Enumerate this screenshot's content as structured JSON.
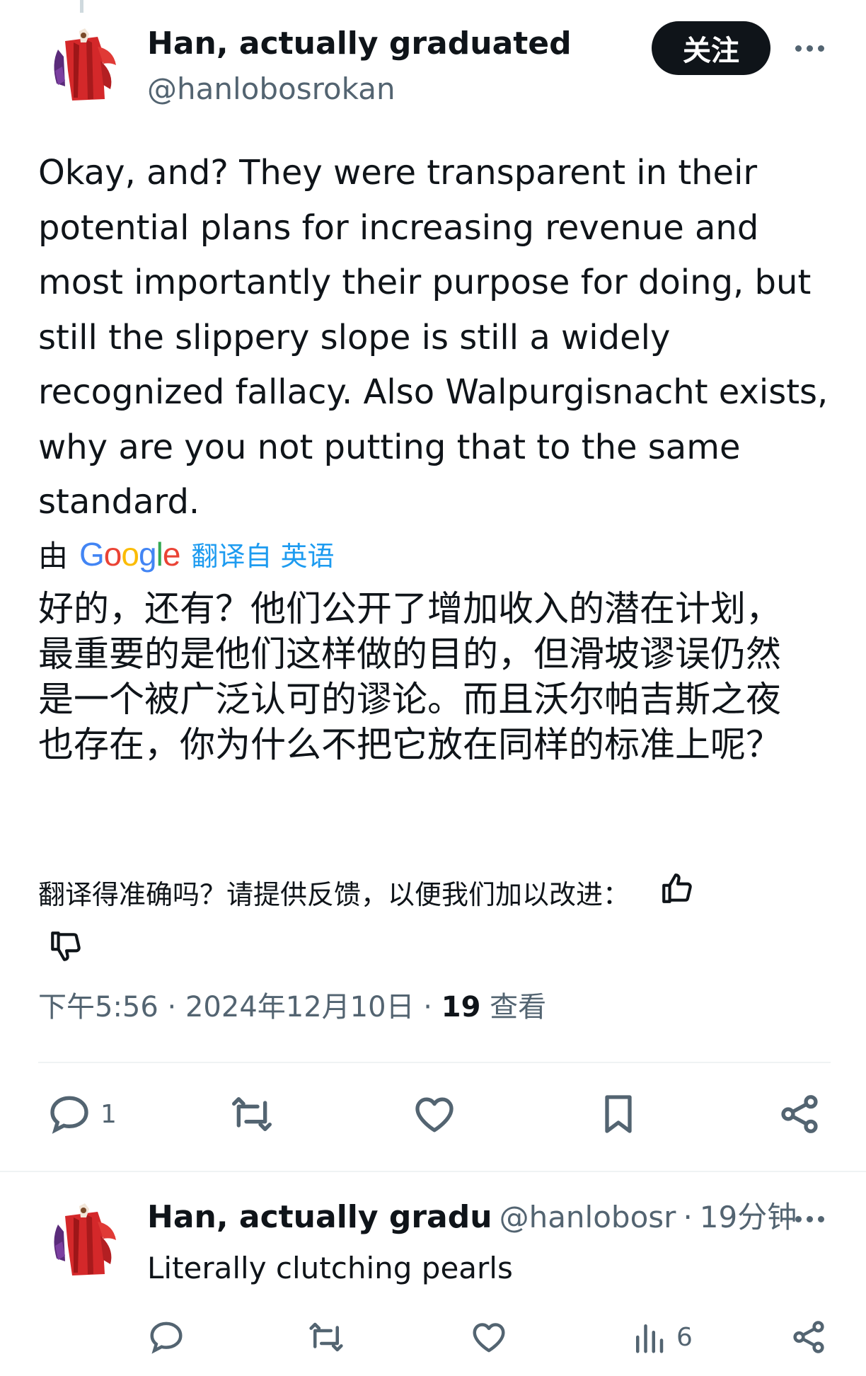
{
  "post": {
    "display_name": "Han, actually graduated",
    "handle": "@hanlobosrokan",
    "follow_label": "关注",
    "text": "Okay, and? They were transparent in their potential plans for increasing revenue and most importantly their purpose for doing, but still the slippery slope is still a widely recognized fallacy. Also Walpurgisnacht exists, why are you not putting that to the same standard.",
    "translation": {
      "by_label": "由",
      "provider": "Google",
      "link_label": "翻译自 英语",
      "text": "好的，还有？他们公开了增加收入的潜在计划，最重要的是他们这样做的目的，但滑坡谬误仍然是一个被广泛认可的谬论。而且沃尔帕吉斯之夜也存在，你为什么不把它放在同样的标准上呢？",
      "feedback_prompt": "翻译得准确吗？请提供反馈，以便我们加以改进："
    },
    "time": "下午5:56",
    "date": "2024年12月10日",
    "views_count": "19",
    "views_label": "查看",
    "actions": {
      "reply_count": "1",
      "icons": [
        "reply-icon",
        "retweet-icon",
        "like-icon",
        "bookmark-icon",
        "share-icon"
      ]
    }
  },
  "reply": {
    "display_name": "Han, actually gradu",
    "handle": "@hanlobosr",
    "time": "19分钟",
    "text": "Literally clutching pearls",
    "views_count": "6",
    "icons": [
      "reply-icon",
      "retweet-icon",
      "like-icon",
      "views-icon",
      "share-icon"
    ]
  },
  "colors": {
    "text": "#0f1419",
    "secondary": "#536471",
    "accent": "#1d9bf0",
    "button_bg": "#0f1419",
    "divider": "#eff3f4"
  }
}
